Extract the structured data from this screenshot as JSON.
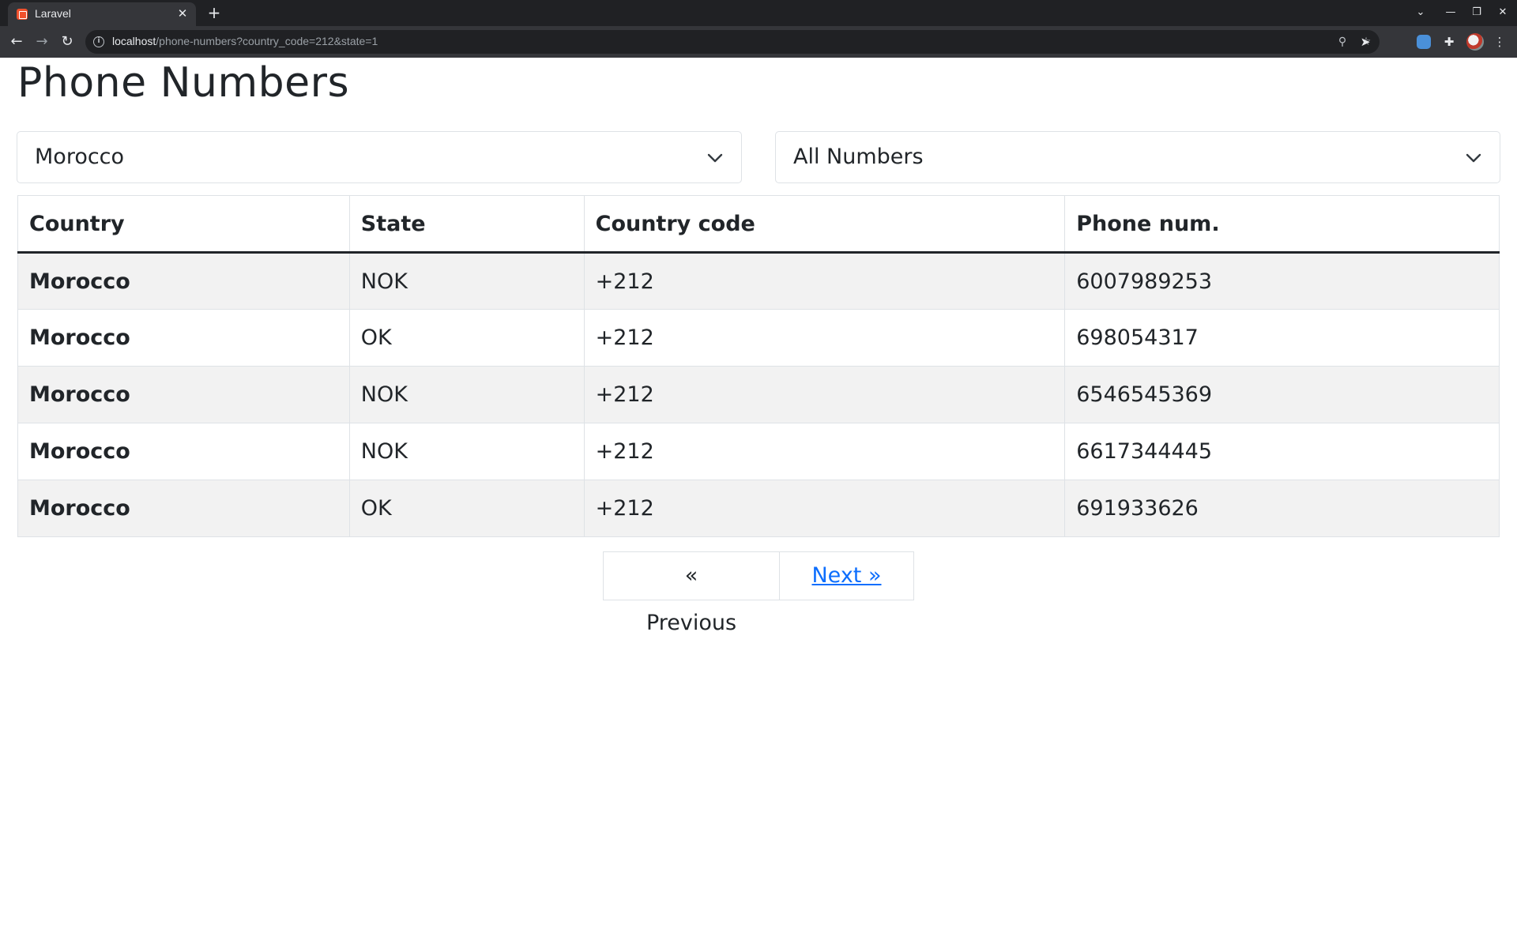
{
  "browser": {
    "tab_title": "Laravel",
    "tab_close": "✕",
    "new_tab": "+",
    "url_host": "localhost",
    "url_path": "/phone-numbers?country_code=212&state=1"
  },
  "page": {
    "title": "Phone Numbers"
  },
  "filters": {
    "country_select": {
      "value": "Morocco"
    },
    "state_select": {
      "value": "All Numbers"
    }
  },
  "table": {
    "headers": [
      "Country",
      "State",
      "Country code",
      "Phone num."
    ],
    "rows": [
      {
        "country": "Morocco",
        "state": "NOK",
        "code": "+212",
        "phone": "6007989253"
      },
      {
        "country": "Morocco",
        "state": "OK",
        "code": "+212",
        "phone": "698054317"
      },
      {
        "country": "Morocco",
        "state": "NOK",
        "code": "+212",
        "phone": "6546545369"
      },
      {
        "country": "Morocco",
        "state": "NOK",
        "code": "+212",
        "phone": "6617344445"
      },
      {
        "country": "Morocco",
        "state": "OK",
        "code": "+212",
        "phone": "691933626"
      }
    ]
  },
  "pagination": {
    "previous_label": "« Previous",
    "next_label": "Next »"
  },
  "colors": {
    "link": "#0d6efd",
    "stripe": "#f2f2f2",
    "chrome_dark": "#202124",
    "chrome_toolbar": "#35363a"
  }
}
